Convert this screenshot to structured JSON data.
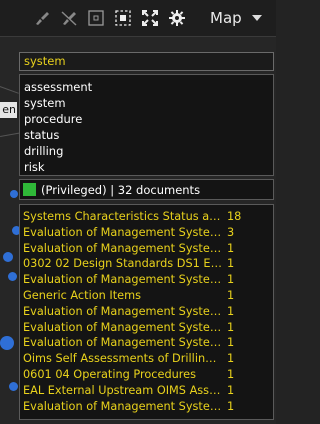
{
  "toolbar": {
    "icons": [
      "brush-icon",
      "brush-off-icon",
      "select-square-icon",
      "focus-square-icon",
      "expand-arrows-icon",
      "gear-icon"
    ],
    "view_label": "Map"
  },
  "background": {
    "partial_label": "en"
  },
  "search": {
    "value": "system"
  },
  "suggestions": [
    "assessment",
    "system",
    "procedure",
    "status",
    "drilling",
    "risk"
  ],
  "summary": {
    "text": "(Privileged) | 32 documents",
    "swatch_color": "#2fb838"
  },
  "results": [
    {
      "title": "Systems Characteristics Status and...",
      "count": "18"
    },
    {
      "title": "Evaluation of Management Systems",
      "count": "3"
    },
    {
      "title": "Evaluation of Management Systems...",
      "count": "1"
    },
    {
      "title": "0302 02 Design Standards DS1 Esta...",
      "count": "1"
    },
    {
      "title": "Evaluation of Management Systems...",
      "count": "1"
    },
    {
      "title": "Generic Action Items",
      "count": "1"
    },
    {
      "title": "Evaluation of Management Systems...",
      "count": "1"
    },
    {
      "title": "Evaluation of Management Systems...",
      "count": "1"
    },
    {
      "title": "Evaluation of Management Systems...",
      "count": "1"
    },
    {
      "title": "Oims Self Assessments of Drilling D...",
      "count": "1"
    },
    {
      "title": "0601 04 Operating Procedures",
      "count": "1"
    },
    {
      "title": "EAL External Upstream OIMS Asses...",
      "count": "1"
    },
    {
      "title": "Evaluation of Management Systems...",
      "count": "1"
    }
  ],
  "colors": {
    "accent_text": "#e9d21c",
    "node": "#2f6fd6"
  }
}
